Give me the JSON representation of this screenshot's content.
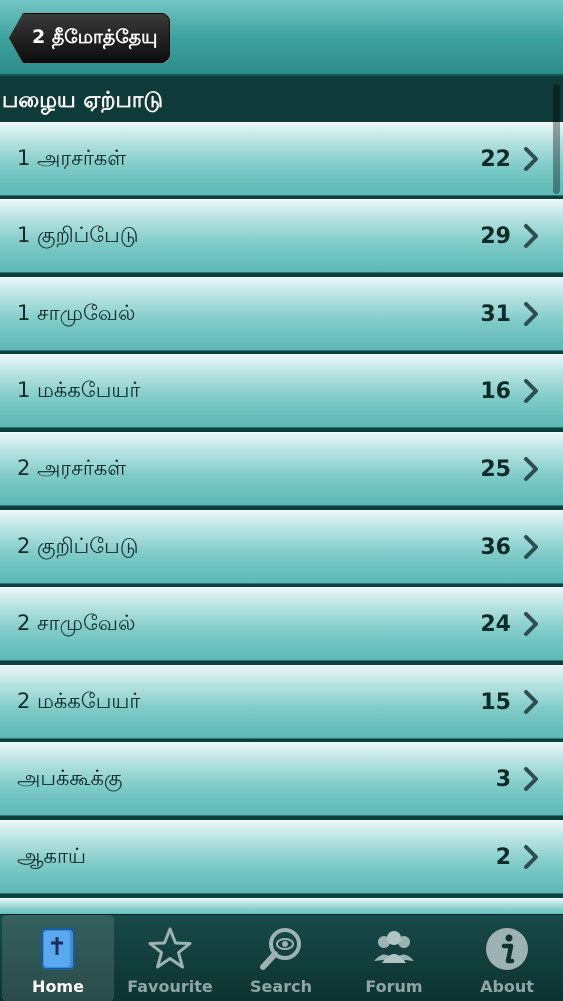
{
  "navbar": {
    "back_label": "2 தீமோத்தேயு"
  },
  "section": {
    "title": "பழைய ஏற்பாடு"
  },
  "books": [
    {
      "name": "1 அரசர்கள்",
      "count": "22"
    },
    {
      "name": "1 குறிப்பேடு",
      "count": "29"
    },
    {
      "name": "1 சாமுவேல்",
      "count": "31"
    },
    {
      "name": "1 மக்கபேயர்",
      "count": "16"
    },
    {
      "name": "2 அரசர்கள்",
      "count": "25"
    },
    {
      "name": "2 குறிப்பேடு",
      "count": "36"
    },
    {
      "name": "2 சாமுவேல்",
      "count": "24"
    },
    {
      "name": "2 மக்கபேயர்",
      "count": "15"
    },
    {
      "name": "அபக்கூக்கு",
      "count": "3"
    },
    {
      "name": "ஆகாய்",
      "count": "2"
    }
  ],
  "tabs": [
    {
      "label": "Home",
      "icon": "bible-icon",
      "selected": true
    },
    {
      "label": "Favourite",
      "icon": "star-icon"
    },
    {
      "label": "Search",
      "icon": "search-icon"
    },
    {
      "label": "Forum",
      "icon": "people-icon"
    },
    {
      "label": "About",
      "icon": "info-icon"
    }
  ]
}
